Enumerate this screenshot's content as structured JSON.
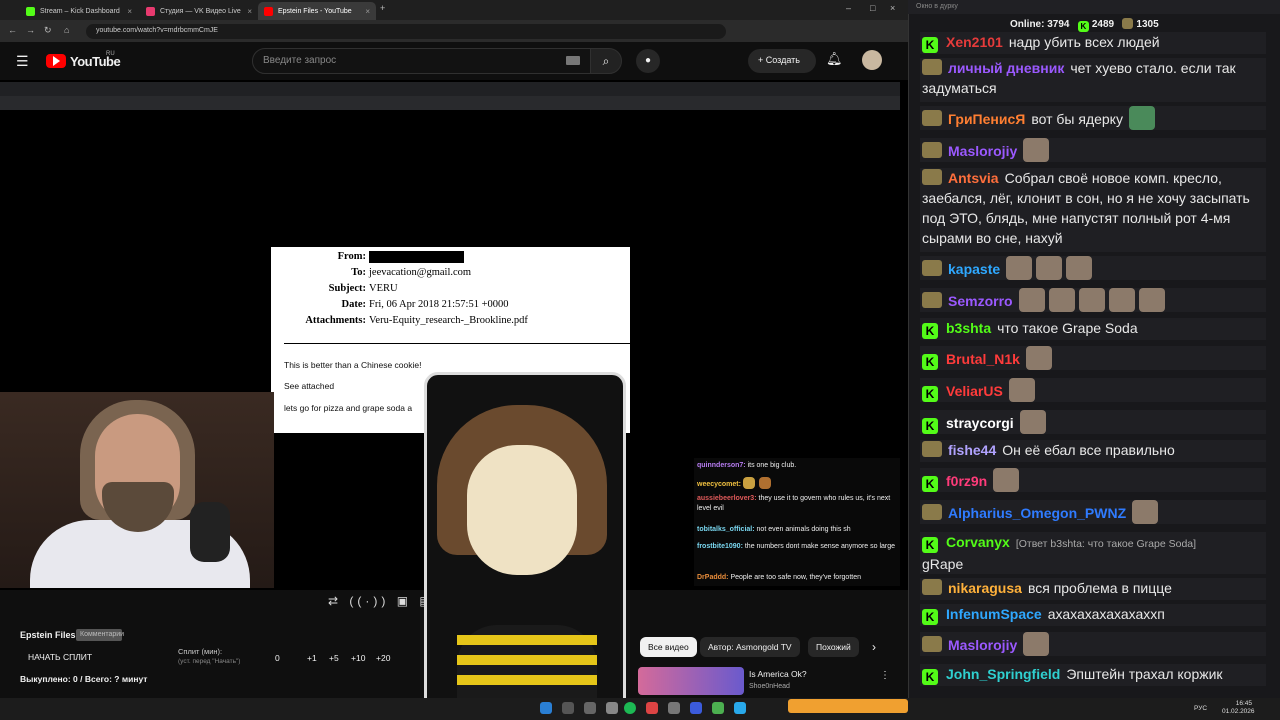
{
  "browser": {
    "tabs": [
      {
        "label": "Stream – Kick Dashboard",
        "color": "#53fc18"
      },
      {
        "label": "Студия — VK Видео Live",
        "color": "#e83a6f"
      },
      {
        "label": "Epstein Files - YouTube",
        "color": "#ff0000"
      }
    ],
    "url": "youtube.com/watch?v=mdrbcmmCmJE"
  },
  "youtube": {
    "logo": "YouTube",
    "region": "RU",
    "search_placeholder": "Введите запрос",
    "create_label": "Создать"
  },
  "email": {
    "from_label": "From:",
    "to_label": "To:",
    "to_value": "jeevacation@gmail.com",
    "subject_label": "Subject:",
    "subject_value": "VERU",
    "date_label": "Date:",
    "date_value": "Fri, 06 Apr 2018 21:57:51 +0000",
    "attachments_label": "Attachments:",
    "attachments_value": "Veru-Equity_research-_Brookline.pdf",
    "body1": "This is better than a Chinese cookie!",
    "body2": "See attached",
    "body3": "lets go for pizza and grape soda a"
  },
  "overlay_chat": [
    {
      "user": "quinnderson7:",
      "text": "its one big club.",
      "color": "#b67cf0"
    },
    {
      "user": "weecycomet:",
      "text": "",
      "color": "#f0c040"
    },
    {
      "user": "aussiebeerlover3:",
      "text": "they use it to govern who rules us, it's next level evil",
      "color": "#e05a5a"
    },
    {
      "user": "tobitalks_official:",
      "text": "not even animals doing this sh",
      "color": "#7ad7f0"
    },
    {
      "user": "frostbite1090:",
      "text": "the numbers dont make sense anymore so large",
      "color": "#7ad7f0"
    },
    {
      "user": "DrPaddd:",
      "text": "People are too safe now, they've forgotten",
      "color": "#e88c3a"
    }
  ],
  "below": {
    "title": "Epstein Files",
    "badge": "Комментарии",
    "split_button": "НАЧАТЬ СПЛИТ",
    "split_label": "Сплит (мин):",
    "split_sub": "(уст. перед \"Начать\")",
    "increments": [
      "0",
      "+1",
      "+5",
      "+10",
      "+20"
    ],
    "bought": "Выкуплено: 0 / Всего: ? минут",
    "chips": [
      "Все видео",
      "Автор: Asmongold TV",
      "Похожий"
    ],
    "rec_title": "Is America Ok?",
    "rec_channel": "Shoe0nHead"
  },
  "chat": {
    "window_title": "Окно в дурку",
    "online_label": "Online:",
    "online_count": "3794",
    "kick_count": "2489",
    "twitch_count": "1305",
    "messages": [
      {
        "platform": "kick",
        "user": "Xen2101",
        "color": "#e63b3b",
        "text": "надр убить всех людей"
      },
      {
        "platform": "twitch",
        "user": "личный дневник",
        "color": "#9b59ff",
        "text": "чет хуево стало. если так задуматься"
      },
      {
        "platform": "twitch",
        "user": "ГриПенисЯ",
        "color": "#ff7f32",
        "text": "вот бы ядерку"
      },
      {
        "platform": "twitch",
        "user": "Maslorojiy",
        "color": "#9b59ff",
        "text": ""
      },
      {
        "platform": "twitch",
        "user": "Antsvia",
        "color": "#ff6f3c",
        "text": "Собрал своё новое комп. кресло, заебался, лёг, клонит в сон, но я не хочу засыпать под ЭТО, блядь, мне напустят полный рот 4-мя сырами во сне, нахуй"
      },
      {
        "platform": "twitch",
        "user": "kapaste",
        "color": "#2fa8ff",
        "text": ""
      },
      {
        "platform": "twitch",
        "user": "Semzorro",
        "color": "#9b59ff",
        "text": ""
      },
      {
        "platform": "kick",
        "user": "b3shta",
        "color": "#53fc18",
        "text": "что такое Grape Soda"
      },
      {
        "platform": "kick",
        "user": "Brutal_N1k",
        "color": "#ff3b3b",
        "text": ""
      },
      {
        "platform": "kick",
        "user": "VeliarUS",
        "color": "#ff3b3b",
        "text": ""
      },
      {
        "platform": "kick",
        "user": "straycorgi",
        "color": "#ffffff",
        "text": ""
      },
      {
        "platform": "twitch",
        "user": "fishe44",
        "color": "#b1a3ff",
        "text": "Он её ебал все правильно"
      },
      {
        "platform": "kick",
        "user": "f0rz9n",
        "color": "#ff3b7a",
        "text": ""
      },
      {
        "platform": "twitch",
        "user": "Alpharius_Omegon_PWNZ",
        "color": "#2f7bff",
        "text": ""
      },
      {
        "platform": "kick",
        "user": "Corvanyx",
        "color": "#53fc18",
        "text": "gRape",
        "reply": "[Ответ b3shta: что такое Grape Soda]"
      },
      {
        "platform": "twitch",
        "user": "nikaragusa",
        "color": "#ffb13b",
        "text": "вся проблема в пицце"
      },
      {
        "platform": "kick",
        "user": "InfenumSpace",
        "color": "#2fa8ff",
        "text": "ахахахахахахаххп"
      },
      {
        "platform": "twitch",
        "user": "Maslorojiy",
        "color": "#9b59ff",
        "text": ""
      },
      {
        "platform": "kick",
        "user": "John_Springfield",
        "color": "#2fd0d0",
        "text": "Эпштейн трахал коржик"
      }
    ]
  },
  "taskbar": {
    "lang": "РУС",
    "time": "16:45",
    "date": "01.02.2026"
  }
}
